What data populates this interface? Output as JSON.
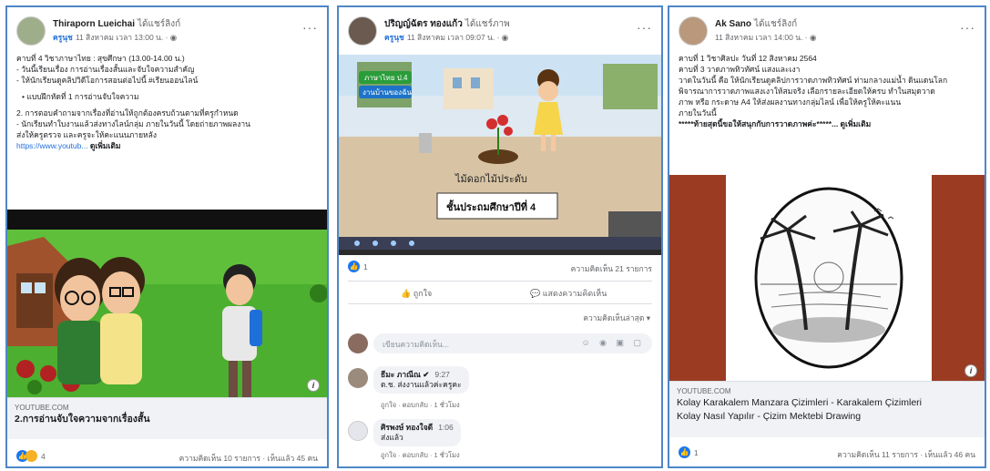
{
  "posts": [
    {
      "author": "Thiraporn Lueichai",
      "author_suffix": "ได้แชร์ลิงก์",
      "tag": "ครูนุช",
      "time": "11 สิงหาคม เวลา 13:00 น. ·",
      "body": [
        "คาบที่ 4 วิชาภาษาไทย : สุขศึกษา  (13.00-14.00 น.)",
        "- วันนี้เรียนเรื่อง การอ่านเรื่องสั้นและจับใจความสำคัญ",
        "- ให้นักเรียนดูคลิปวิดีโอการสอนต่อไปนี้ #เรียนออนไลน์",
        "•  แบบฝึกหัดที่ 1  การอ่านจับใจความ",
        "2. การตอบคำถามจากเรื่องที่อ่านให้ถูกต้องครบถ้วนตามที่ครูกำหนด",
        "- นักเรียนทำใบงานแล้วส่งทางไลน์กลุ่ม ภายในวันนี้ โดยถ่ายภาพผลงาน",
        "ส่งให้ครูตรวจ และครูจะให้คะแนนภายหลัง"
      ],
      "link_text": "https://www.youtub...",
      "see_more": "ดูเพิ่มเติม",
      "link_source": "YOUTUBE.COM",
      "link_title": "2.การอ่านจับใจความจากเรื่องสั้น",
      "reaction_count": "4",
      "right_stat": "ความคิดเห็น 10 รายการ · เห็นแล้ว 45 คน"
    },
    {
      "author": "ปริญญ์ฉัตร ทองแก้ว",
      "author_suffix": "ได้แชร์ภาพ",
      "tag": "ครูนุช",
      "time": "11 สิงหาคม เวลา 09:07 น. ·",
      "slide_top": "ภาษาไทย ป.4",
      "slide_tag": "งานบ้านของฉัน",
      "slide_label": "ไม้ดอกไม้ประดับ",
      "slide_grade": "ชั้นประถมศึกษาปีที่ 4",
      "reaction_count": "1",
      "right_stat": "ความคิดเห็น 21 รายการ",
      "like_label": "ถูกใจ",
      "comment_label": "แสดงความคิดเห็น",
      "sort_label": "ความคิดเห็นล่าสุด ▾",
      "comment_placeholder": "เขียนความคิดเห็น...",
      "comment_icons": "☺ ◉ ▣ ▢",
      "comments": [
        {
          "name": "ธีมะ ภาณีณ ✔",
          "time": "9:27",
          "text": "ด.ช. ส่งงานแล้วค่ะครูคะ",
          "actions": "ถูกใจ · ตอบกลับ · 1 ชั่วโมง"
        },
        {
          "name": "ศิรพงษ์ ทองใจดี",
          "time": "1:06",
          "text": "ส่งแล้ว",
          "actions": "ถูกใจ · ตอบกลับ · 1 ชั่วโมง"
        }
      ]
    },
    {
      "author": "Ak Sano",
      "author_suffix": "ได้แชร์ลิงก์",
      "time": "11 สิงหาคม เวลา 14:00 น. ·",
      "body": [
        "คาบที่ 1 วิชาศิลปะ วันที่ 12 สิงหาคม 2564",
        "คาบที่ 3 วาดภาพทิวทัศน์ แสงและเงา",
        "วาดในวันนี้ คือ ให้นักเรียนดูคลิปการวาดภาพทิวทัศน์ ท่ามกลางแม่น้ำ ดินแดนโลก",
        "พิจารณาการวาดภาพแสงเงาให้สมจริง เลือกรายละเอียดให้ครบ ทำในสมุดวาด",
        "ภาพ หรือ กระดาษ A4 ให้ส่งผลงานทางกลุ่มไลน์ เพื่อให้ครูให้คะแนน",
        "ภายในวันนี้",
        "*****ท้ายสุดนี้ขอให้สนุกกับการวาดภาพค่ะ*****... ดูเพิ่มเติม"
      ],
      "link_source": "YOUTUBE.COM",
      "link_title_1": "Kolay Karakalem Manzara Çizimleri - Karakalem Çizimleri",
      "link_title_2": "Kolay Nasıl Yapılır - Çizim Mektebi Drawing",
      "reaction_count": "1",
      "right_stat": "ความคิดเห็น 11 รายการ · เห็นแล้ว 46 คน"
    }
  ]
}
